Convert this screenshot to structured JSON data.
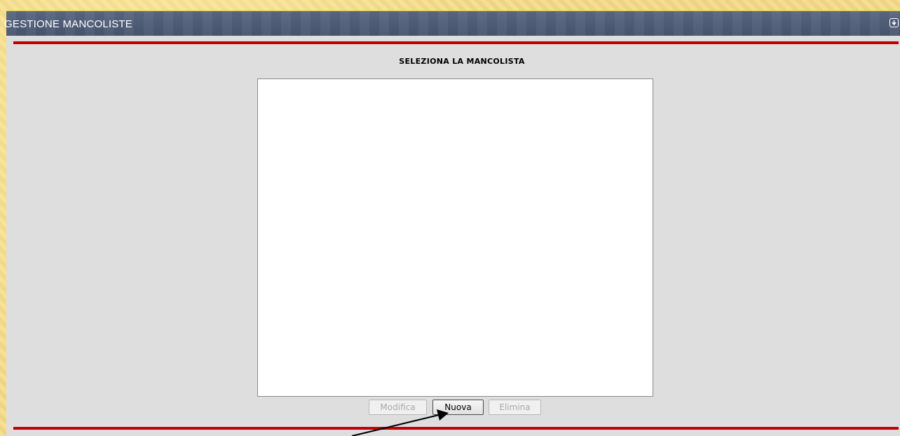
{
  "window": {
    "title": "GESTIONE MANCOLISTE",
    "collapse_icon": "collapse-down-icon"
  },
  "main": {
    "section_title": "SELEZIONA LA MANCOLISTA",
    "list_items": [],
    "buttons": {
      "modifica_label": "Modifica",
      "nuova_label": "Nuova",
      "elimina_label": "Elimina"
    }
  },
  "colors": {
    "titlebar": "#4e5c77",
    "accent_line": "#c00000",
    "panel": "#dedede",
    "background": "#f5dc8a"
  }
}
